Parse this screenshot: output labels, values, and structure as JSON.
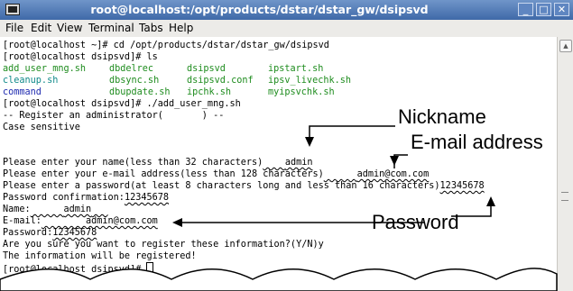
{
  "window": {
    "title": "root@localhost:/opt/products/dstar/dstar_gw/dsipsvd",
    "buttons": [
      "_",
      "□",
      "✕"
    ]
  },
  "menu": [
    {
      "label": "File"
    },
    {
      "label": "Edit"
    },
    {
      "label": "View"
    },
    {
      "label": "Terminal"
    },
    {
      "label": "Tabs"
    },
    {
      "label": "Help"
    }
  ],
  "terminal": {
    "l1": "[root@localhost ~]# cd /opt/products/dstar/dstar_gw/dsipsvd",
    "l2": "[root@localhost dsipsvd]# ls",
    "ls_row1": [
      "add_user_mng.sh",
      "dbdelrec",
      "dsipsvd",
      "ipstart.sh"
    ],
    "ls_row2": [
      "cleanup.sh",
      "dbsync.sh",
      "dsipsvd.conf",
      "ipsv_livechk.sh"
    ],
    "ls_row3": [
      "command",
      "dbupdate.sh",
      "ipchk.sh",
      "myipsvchk.sh"
    ],
    "l6": "[root@localhost dsipsvd]# ./add_user_mng.sh",
    "l7": "-- Register an administrator(       ) --",
    "l8": "Case sensitive",
    "name_prompt": "Please enter your name(less than 32 characters)",
    "name_value": "admin",
    "email_prompt": "Please enter your e-mail address(less than 128 characters)",
    "email_value": "admin@com.com",
    "pw_prompt": "Please enter a password(at least 8 characters long and less than 16 characters)",
    "pw_value": "12345678",
    "confirm_prompt": "Password confirmation:",
    "confirm_value": "12345678",
    "name_label": "Name:",
    "email_label": "E-mail:",
    "password_label": "Password:",
    "confirm_question": "Are you sure you want to register these information?(Y/N)y",
    "done": "The information will be registered!",
    "final_prompt": "[root@localhost dsipsvd]# "
  },
  "annotations": {
    "nickname": "Nickname",
    "email": "E-mail address",
    "password": "Password"
  },
  "colors": {
    "titlebar": "#4f78b6",
    "script_green": "#1e8c1e",
    "script_cyan": "#118a8a",
    "dir_blue": "#1f2bb0"
  }
}
